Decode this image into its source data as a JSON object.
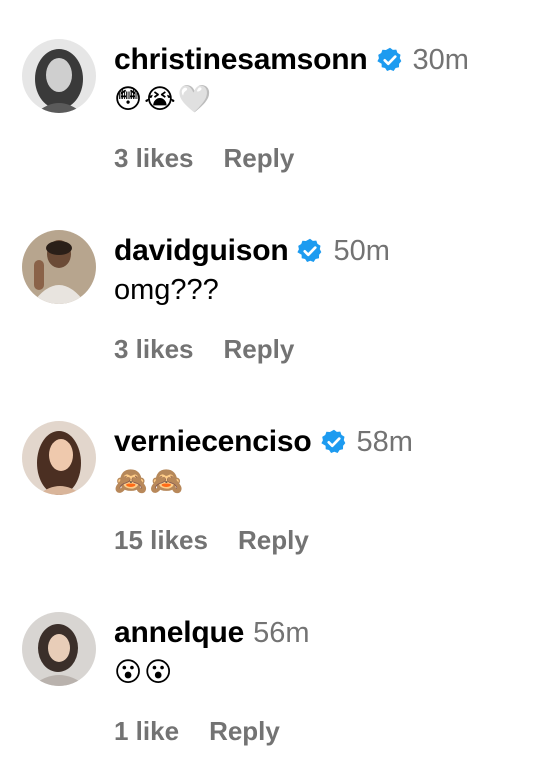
{
  "colors": {
    "verified_badge": "#1D9BF0",
    "secondary_text": "#737373",
    "primary_text": "#000000"
  },
  "comments": [
    {
      "username": "christinesamsonn",
      "verified": true,
      "time": "30m",
      "text": "",
      "emojis": [
        "😳",
        "😭",
        "🤍"
      ],
      "likes": "3 likes",
      "reply": "Reply"
    },
    {
      "username": "davidguison",
      "verified": true,
      "time": "50m",
      "text": "omg???",
      "emojis": [],
      "likes": "3 likes",
      "reply": "Reply"
    },
    {
      "username": "verniecenciso",
      "verified": true,
      "time": "58m",
      "text": "",
      "emojis": [
        "🙈",
        "🙈"
      ],
      "likes": "15 likes",
      "reply": "Reply"
    },
    {
      "username": "annelque",
      "verified": false,
      "time": "56m",
      "text": "",
      "emojis": [
        "😮",
        "😮"
      ],
      "likes": "1 like",
      "reply": "Reply"
    }
  ]
}
